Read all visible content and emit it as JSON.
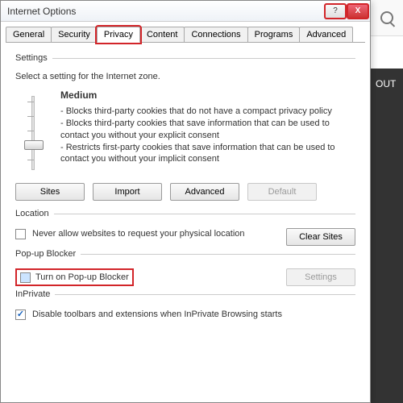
{
  "bg": {
    "search_placeholder": "",
    "right_label": "OUT"
  },
  "dialog": {
    "title": "Internet Options",
    "help_label": "?",
    "close_label": "X",
    "tabs": [
      "General",
      "Security",
      "Privacy",
      "Content",
      "Connections",
      "Programs",
      "Advanced"
    ],
    "active_tab_index": 2
  },
  "settings": {
    "legend": "Settings",
    "intro": "Select a setting for the Internet zone.",
    "level_name": "Medium",
    "bullets": [
      "- Blocks third-party cookies that do not have a compact privacy policy",
      "- Blocks third-party cookies that save information that can be used to contact you without your explicit consent",
      "- Restricts first-party cookies that save information that can be used to contact you without your implicit consent"
    ],
    "buttons": {
      "sites": "Sites",
      "import": "Import",
      "advanced": "Advanced",
      "default": "Default"
    }
  },
  "location": {
    "legend": "Location",
    "never_allow": "Never allow websites to request your physical location",
    "clear_sites": "Clear Sites"
  },
  "popup": {
    "legend": "Pop-up Blocker",
    "turn_on": "Turn on Pop-up Blocker",
    "settings": "Settings"
  },
  "inprivate": {
    "legend": "InPrivate",
    "disable_toolbars": "Disable toolbars and extensions when InPrivate Browsing starts"
  }
}
